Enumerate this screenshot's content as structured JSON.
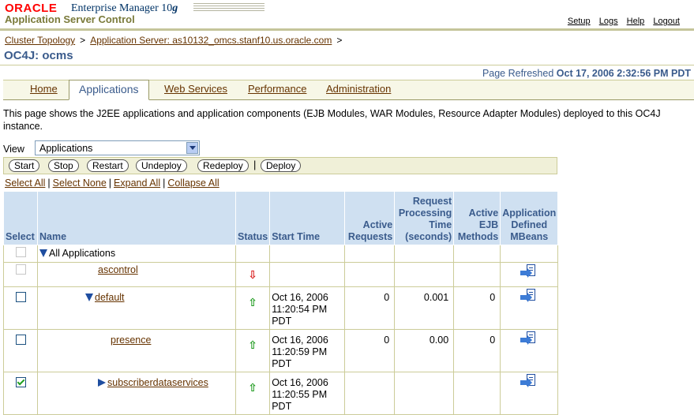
{
  "header": {
    "oracle": "ORACLE",
    "product": "Enterprise Manager 10",
    "product_g": "g",
    "subtitle": "Application Server Control",
    "links": [
      "Setup",
      "Logs",
      "Help",
      "Logout"
    ]
  },
  "breadcrumb": {
    "items": [
      "Cluster Topology",
      "Application Server: as10132_omcs.stanf10.us.oracle.com"
    ],
    "separator": ">"
  },
  "page_title": "OC4J: ocms",
  "refresh": {
    "label": "Page Refreshed",
    "value": "Oct 17, 2006 2:32:56 PM PDT"
  },
  "tabs": [
    "Home",
    "Applications",
    "Web Services",
    "Performance",
    "Administration"
  ],
  "active_tab": "Applications",
  "intro": "This page shows the J2EE applications and application components (EJB Modules, WAR Modules, Resource Adapter Modules) deployed to this OC4J instance.",
  "view": {
    "label": "View",
    "value": "Applications"
  },
  "actions": [
    "Start",
    "Stop",
    "Restart",
    "Undeploy",
    "Redeploy",
    "Deploy"
  ],
  "selection_links": [
    "Select All",
    "Select None",
    "Expand All",
    "Collapse All"
  ],
  "table": {
    "headers": [
      "Select",
      "Name",
      "Status",
      "Start Time",
      "Active Requests",
      "Request Processing Time (seconds)",
      "Active EJB Methods",
      "Application Defined MBeans"
    ],
    "rows": [
      {
        "name": "All Applications",
        "status": "",
        "start": "",
        "active": "",
        "rpt": "",
        "ejb": "",
        "mbeans": false,
        "checked": false,
        "disabled": true,
        "link": false
      },
      {
        "name": "ascontrol",
        "status": "down",
        "start": "",
        "active": "",
        "rpt": "",
        "ejb": "",
        "mbeans": true,
        "checked": false,
        "disabled": true,
        "link": true
      },
      {
        "name": "default",
        "status": "up",
        "start": "Oct 16, 2006 11:20:54 PM PDT",
        "active": "0",
        "rpt": "0.001",
        "ejb": "0",
        "mbeans": true,
        "checked": false,
        "disabled": false,
        "link": true
      },
      {
        "name": "presence",
        "status": "up",
        "start": "Oct 16, 2006 11:20:59 PM PDT",
        "active": "0",
        "rpt": "0.00",
        "ejb": "0",
        "mbeans": true,
        "checked": false,
        "disabled": false,
        "link": true
      },
      {
        "name": "subscriberdataservices",
        "status": "up",
        "start": "Oct 16, 2006 11:20:55 PM PDT",
        "active": "",
        "rpt": "",
        "ejb": "",
        "mbeans": true,
        "checked": true,
        "disabled": false,
        "link": true
      }
    ]
  },
  "colors": {
    "header_bg": "#cfe0f1",
    "header_text": "#3a5b8c",
    "link": "#663300",
    "status_up": "#1d9a1d",
    "status_down": "#d81818"
  }
}
